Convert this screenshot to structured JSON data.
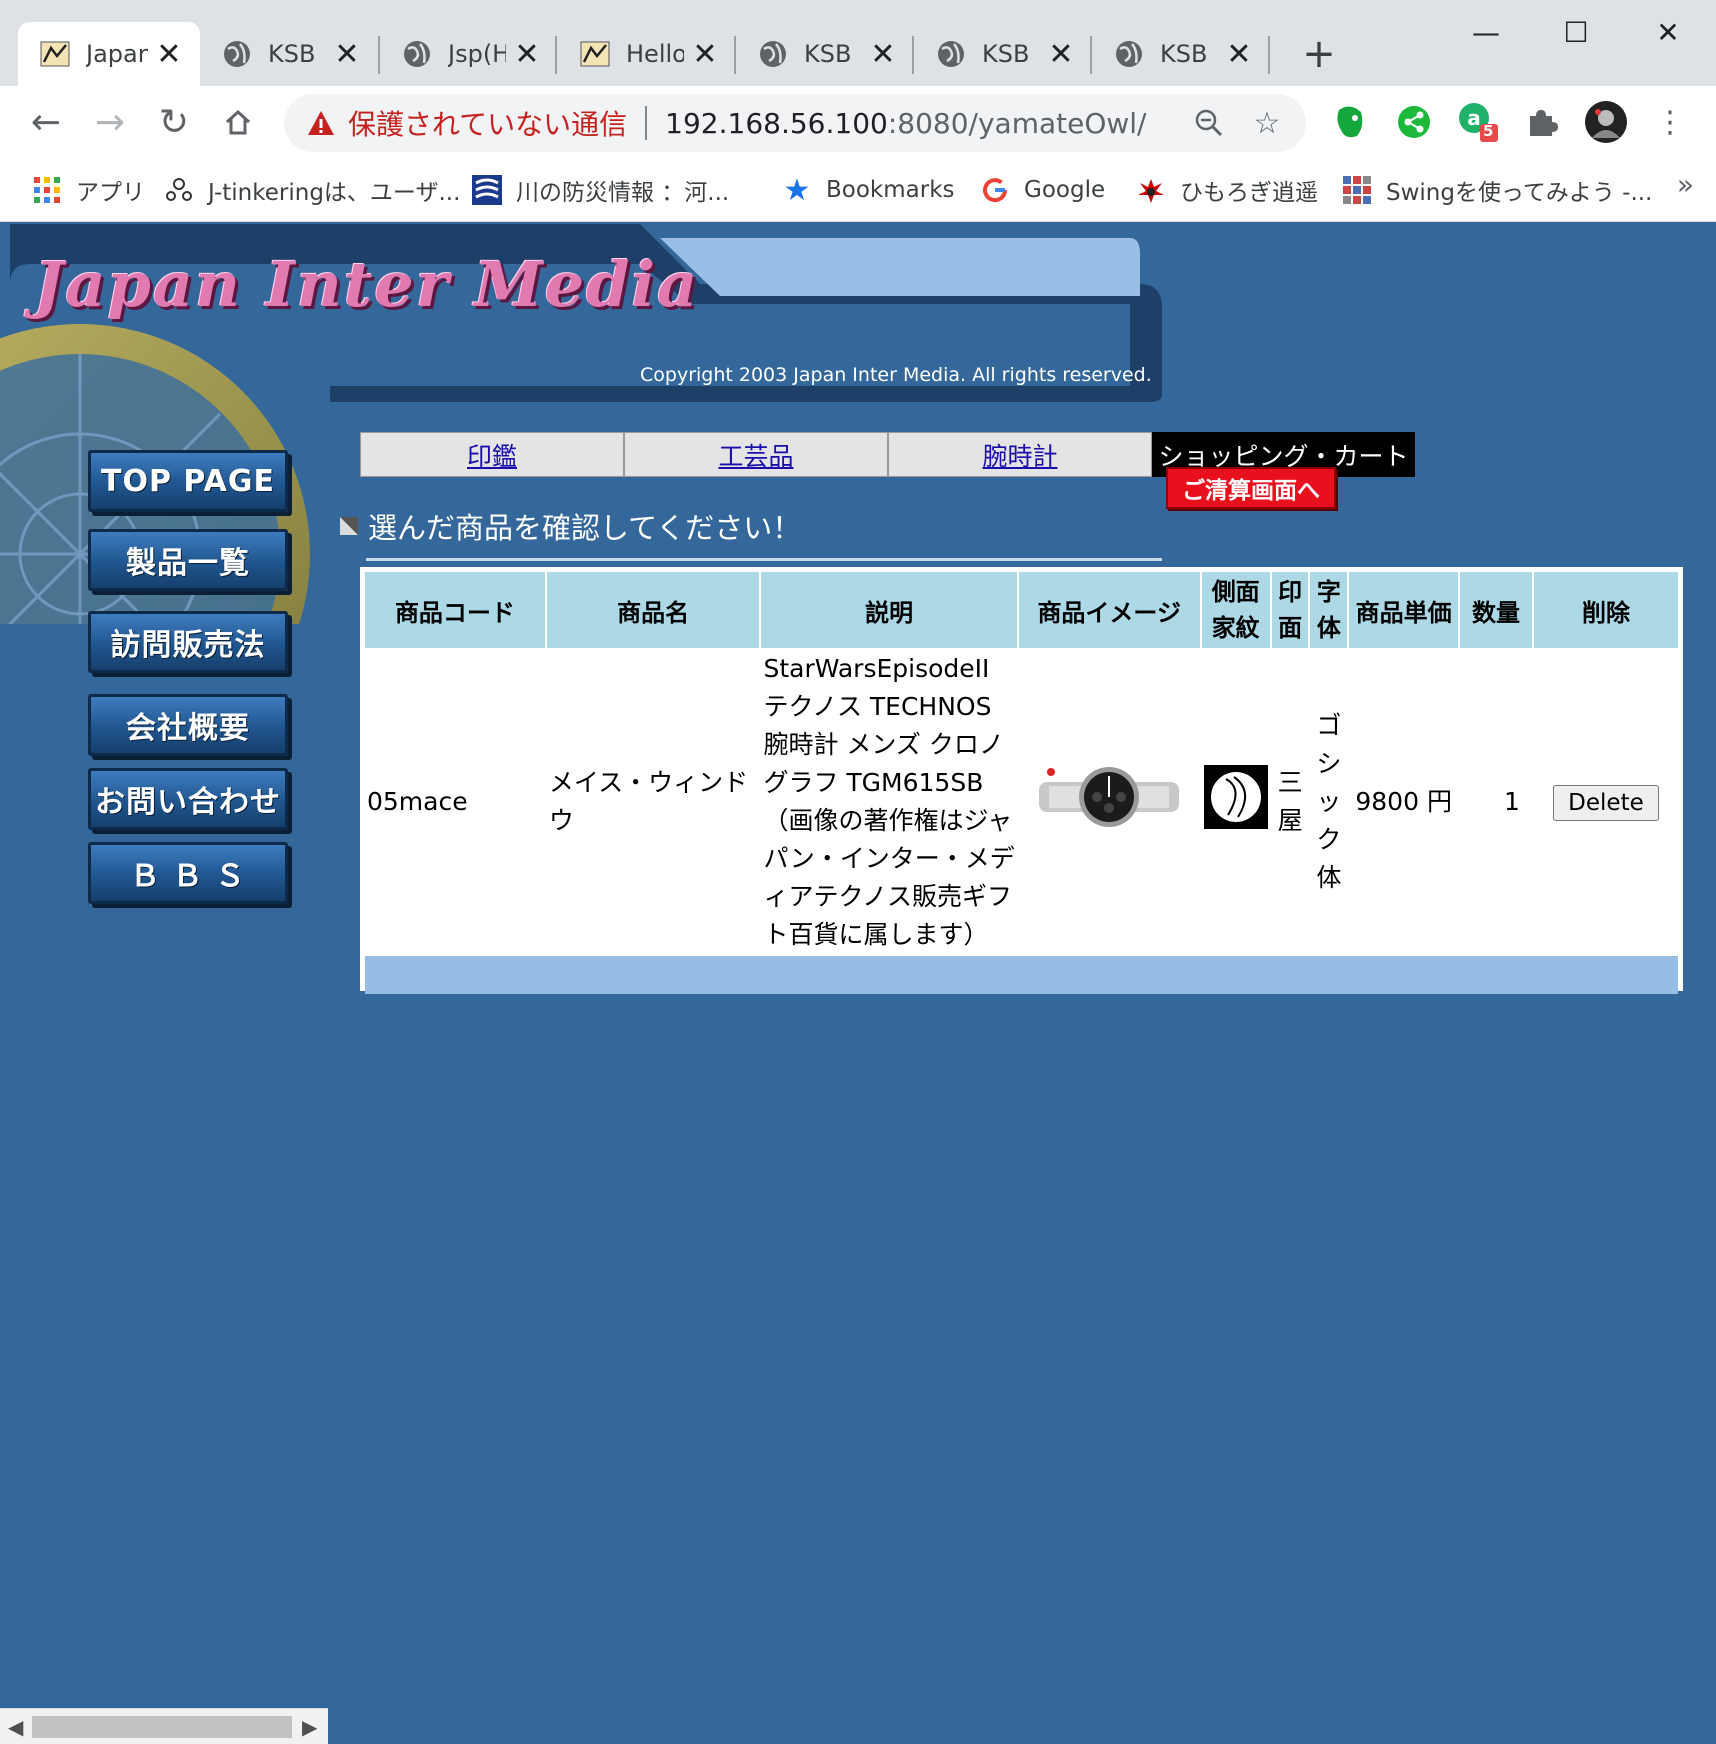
{
  "browser": {
    "tabs": [
      {
        "title": "Japan Inter Media",
        "icon": "tomcat-icon",
        "active": true
      },
      {
        "title": "KSB",
        "icon": "globe-icon",
        "active": false
      },
      {
        "title": "Jsp(H",
        "icon": "globe-icon",
        "active": false
      },
      {
        "title": "Hello",
        "icon": "tomcat-icon",
        "active": false
      },
      {
        "title": "KSB",
        "icon": "globe-icon",
        "active": false
      },
      {
        "title": "KSB",
        "icon": "globe-icon",
        "active": false
      },
      {
        "title": "KSB",
        "icon": "globe-icon",
        "active": false
      }
    ],
    "security_label": "保護されていない通信",
    "url_host": "192.168.56.100",
    "url_rest": ":8080/yamateOwl/",
    "extension_badge": "5",
    "bookmarks": [
      {
        "label": "アプリ",
        "icon": "apps-grid-icon"
      },
      {
        "label": "J-tinkeringは、ユーザ...",
        "icon": "network-icon"
      },
      {
        "label": "川の防災情報 ：河...",
        "icon": "river-logo-icon"
      },
      {
        "label": "Bookmarks",
        "icon": "star-icon"
      },
      {
        "label": "Google",
        "icon": "google-icon"
      },
      {
        "label": "ひもろぎ逍遥",
        "icon": "crest-icon"
      },
      {
        "label": "Swingを使ってみよう -...",
        "icon": "grid-logo-icon"
      }
    ]
  },
  "page": {
    "logo_text": "Japan Inter Media",
    "copyright": "Copyright 2003 Japan Inter Media. All rights reserved.",
    "side_menu": [
      "TOP PAGE",
      "製品一覧",
      "訪問販売法",
      "会社概要",
      "お問い合わせ",
      "Ｂ Ｂ Ｓ"
    ],
    "tabs": [
      "印鑑",
      "工芸品",
      "腕時計",
      "ショッピング・カート"
    ],
    "checkout_label": "ご清算画面へ",
    "message": "選んだ商品を確認してください！",
    "cart": {
      "headers": [
        "商品コード",
        "商品名",
        "説明",
        "商品イメージ",
        "側面家紋",
        "印面",
        "字体",
        "商品単価",
        "数量",
        "削除"
      ],
      "rows": [
        {
          "code": "05mace",
          "name": "メイス・ウィンドウ",
          "description": "StarWarsEpisodeII テクノス TECHNOS 腕時計 メンズ クロノグラフ TGM615SB （画像の著作権はジャパン・インター・メディアテクノス販売ギフト百貨に属します）",
          "seal_face": "三屋",
          "font": "ゴシック体",
          "price": "9800 円",
          "qty": "1",
          "delete_label": "Delete"
        }
      ]
    }
  },
  "colors": {
    "page_bg": "#34679a",
    "table_header": "#add8e6",
    "table_footer": "#96bde3",
    "checkout_red": "#e8101c"
  }
}
